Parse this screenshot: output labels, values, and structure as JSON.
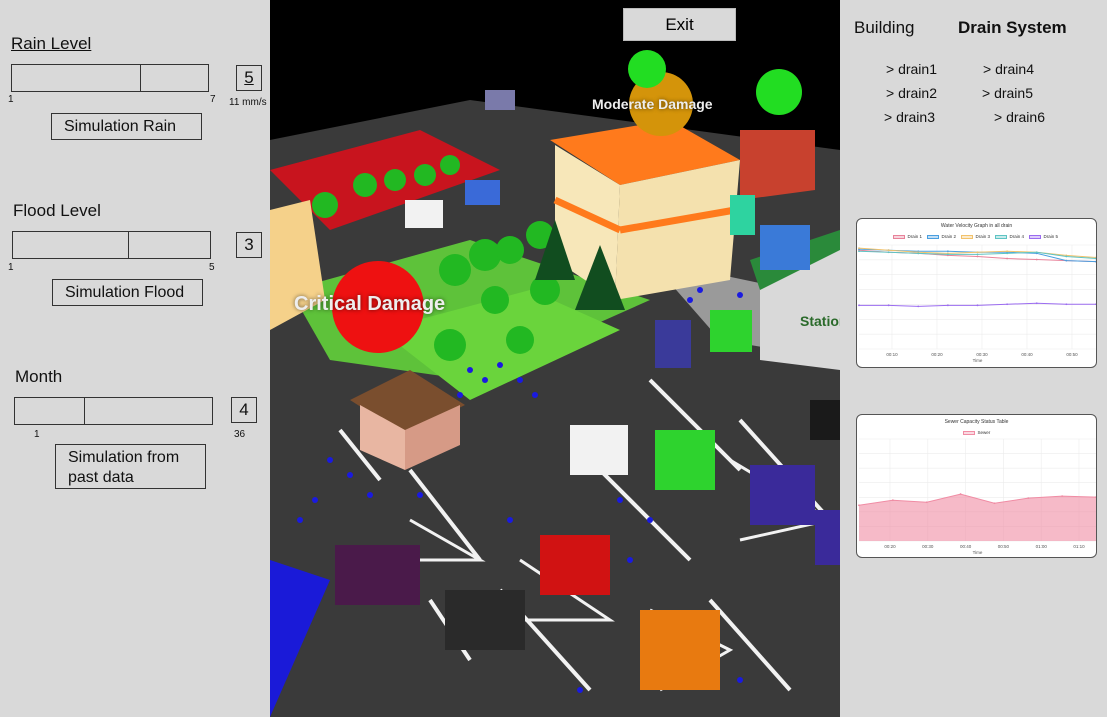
{
  "left": {
    "rain": {
      "label": "Rain Level",
      "min": "1",
      "max": "7",
      "value": "5",
      "unit": "11 mm/s",
      "button": "Simulation Rain"
    },
    "flood": {
      "label": "Flood Level",
      "min": "1",
      "max": "5",
      "value": "3",
      "button": "Simulation Flood"
    },
    "month": {
      "label": "Month",
      "min": "1",
      "max": "36",
      "value": "4",
      "button": "Simulation from past data"
    }
  },
  "viewport": {
    "exit_label": "Exit",
    "moderate_label": "Moderate Damage",
    "critical_label": "Critical Damage",
    "station_label": "Station",
    "colors": {
      "critical": "#ee1111",
      "moderate": "#d4940a",
      "ok": "#22dd22"
    }
  },
  "right": {
    "tabs": {
      "building": "Building",
      "drain_system": "Drain System"
    },
    "drains": [
      "> drain1",
      "> drain2",
      "> drain3",
      "> drain4",
      "> drain5",
      "> drain6"
    ],
    "velocity_chart_title": "Water Velocity Graph in all drain",
    "sewer_chart_title": "Sewer Capacity Status Table"
  },
  "chart_data": [
    {
      "type": "line",
      "title": "Water Velocity Graph in all drain",
      "xlabel": "Time",
      "ylabel": "",
      "x": [
        "00:10",
        "00:20",
        "00:30",
        "00:40",
        "00:50"
      ],
      "series": [
        {
          "name": "Drain 1",
          "color": "#e8829a",
          "values": [
            0.95,
            0.93,
            0.92,
            0.9,
            0.89,
            0.87,
            0.86,
            0.85,
            0.84
          ]
        },
        {
          "name": "Drain 2",
          "color": "#4a9fe0",
          "values": [
            0.96,
            0.95,
            0.94,
            0.94,
            0.93,
            0.93,
            0.92,
            0.85,
            0.84
          ]
        },
        {
          "name": "Drain 3",
          "color": "#f2c26b",
          "values": [
            0.97,
            0.95,
            0.93,
            0.92,
            0.93,
            0.94,
            0.93,
            0.9,
            0.88
          ]
        },
        {
          "name": "Drain 4",
          "color": "#5ec4c4",
          "values": [
            0.94,
            0.93,
            0.92,
            0.91,
            0.91,
            0.92,
            0.93,
            0.89,
            0.87
          ]
        },
        {
          "name": "Drain 5",
          "color": "#9b6cf0",
          "values": [
            0.42,
            0.42,
            0.41,
            0.42,
            0.42,
            0.43,
            0.44,
            0.43,
            0.43
          ]
        }
      ],
      "ylim": [
        0,
        1
      ],
      "grid": true,
      "legend": "top"
    },
    {
      "type": "area",
      "title": "Sewer Capacity Status Table",
      "xlabel": "Time",
      "ylabel": "",
      "x": [
        "00:20",
        "00:30",
        "00:40",
        "00:50",
        "01:00",
        "01:10"
      ],
      "series": [
        {
          "name": "Sewer",
          "color": "#f08ca4",
          "values": [
            0.35,
            0.4,
            0.38,
            0.46,
            0.37,
            0.42,
            0.44,
            0.43
          ]
        }
      ],
      "ylim": [
        0,
        1
      ],
      "grid": true,
      "legend": "top"
    }
  ]
}
